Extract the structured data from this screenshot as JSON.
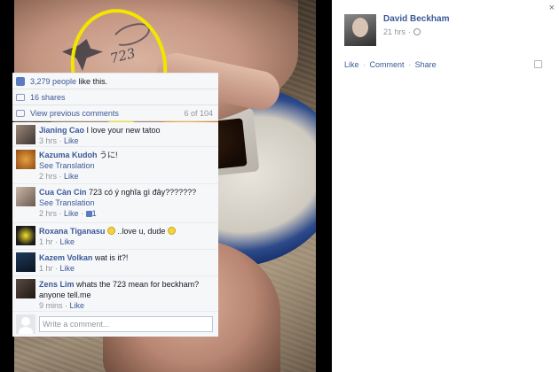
{
  "post": {
    "author": "David Beckham",
    "time": "21 hrs",
    "close_glyph": "×",
    "actions": {
      "like": "Like",
      "comment": "Comment",
      "share": "Share",
      "sep": "·"
    }
  },
  "stats": {
    "likes": "3,279 people",
    "likes_suffix": " like this.",
    "shares": "16 shares",
    "view_previous": "View previous comments",
    "count": "6 of 104"
  },
  "comments": [
    {
      "name": "Jianing Cao",
      "text": " I love your new tatoo",
      "time": "3 hrs",
      "like": "Like",
      "translation": "",
      "likes": ""
    },
    {
      "name": "Kazuma Kudoh",
      "text": " うに!",
      "time": "2 hrs",
      "like": "Like",
      "translation": "See Translation",
      "likes": ""
    },
    {
      "name": "Cua Càn Cin",
      "text": " 723 có ý nghĩa gì đây???????",
      "time": "2 hrs",
      "like": "Like",
      "translation": "See Translation",
      "likes": "1"
    },
    {
      "name": "Roxana Tiganasu",
      "text": " ..love u, dude ",
      "time": "1 hr",
      "like": "Like",
      "translation": "",
      "likes": ""
    },
    {
      "name": "Kazem Volkan",
      "text": " wat is it?!",
      "time": "1 hr",
      "like": "Like",
      "translation": "",
      "likes": ""
    },
    {
      "name": "Zens Lim",
      "text": " whats the 723 mean for beckham? anyone tell.me",
      "time": "9 mins",
      "like": "Like",
      "translation": "",
      "likes": ""
    }
  ],
  "composer": {
    "placeholder": "Write a comment..."
  },
  "photo": {
    "tattoo_text": "723",
    "annotation_color": "#f2e600"
  },
  "colors": {
    "link": "#3b5998",
    "meta": "#90949c",
    "panel_bg": "#f6f7f9"
  },
  "icons": [
    "close-icon",
    "globe-icon",
    "tag-icon",
    "like-icon",
    "share-icon",
    "comment-icon",
    "smiley-icon",
    "thumb-icon",
    "default-avatar-icon"
  ]
}
